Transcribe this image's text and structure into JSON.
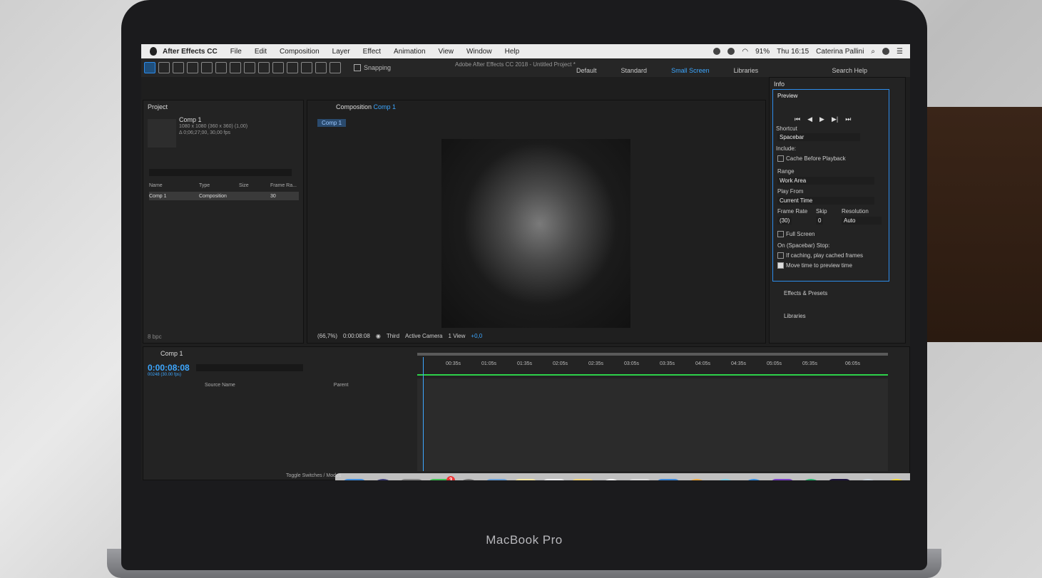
{
  "menubar": {
    "app": "After Effects CC",
    "items": [
      "File",
      "Edit",
      "Composition",
      "Layer",
      "Effect",
      "Animation",
      "View",
      "Window",
      "Help"
    ],
    "battery": "91%",
    "clock": "Thu 16:15",
    "user": "Caterina Pallini"
  },
  "toolbar": {
    "window_title": "Adobe After Effects CC 2018 - Untitled Project *",
    "snapping": "Snapping",
    "workspaces": [
      "Default",
      "Standard",
      "Small Screen",
      "Libraries"
    ],
    "active_workspace": "Small Screen",
    "search_help": "Search Help"
  },
  "project": {
    "title": "Project",
    "comp_name": "Comp 1",
    "comp_info_line1": "1080 x 1080 (360 x 360) (1,00)",
    "comp_info_line2": "Δ 0;06;27;00, 30,00 fps",
    "columns": [
      "Name",
      "Type",
      "Size",
      "Frame Ra..."
    ],
    "row": {
      "name": "Comp 1",
      "type": "Composition",
      "frame_rate": "30"
    },
    "bpc": "8 bpc"
  },
  "composition": {
    "panel_title": "Composition",
    "comp_link": "Comp 1",
    "tab": "Comp 1",
    "zoom": "(66,7%)",
    "timecode": "0:00:08:08",
    "resolution": "Third",
    "camera": "Active Camera",
    "views": "1 View",
    "exposure": "+0,0"
  },
  "right_panel": {
    "info": "Info",
    "preview": "Preview",
    "shortcut_label": "Shortcut",
    "shortcut_value": "Spacebar",
    "include_label": "Include:",
    "cache_before": "Cache Before Playback",
    "range_label": "Range",
    "range_value": "Work Area",
    "play_from_label": "Play From",
    "play_from_value": "Current Time",
    "frame_rate_label": "Frame Rate",
    "skip_label": "Skip",
    "resolution_label": "Resolution",
    "frame_rate_value": "(30)",
    "skip_value": "0",
    "resolution_value": "Auto",
    "full_screen": "Full Screen",
    "on_stop": "On (Spacebar) Stop:",
    "if_caching": "If caching, play cached frames",
    "move_time": "Move time to preview time",
    "effects_presets": "Effects & Presets",
    "libraries": "Libraries"
  },
  "timeline": {
    "tab": "Comp 1",
    "timecode": "0:00:08:08",
    "timecode_sub": "00248 (30.00 fps)",
    "col_source": "Source Name",
    "col_parent": "Parent",
    "ruler": [
      "00:35s",
      "01:05s",
      "01:35s",
      "02:05s",
      "02:35s",
      "03:05s",
      "03:35s",
      "04:05s",
      "04:35s",
      "05:05s",
      "05:35s",
      "06:05s"
    ],
    "toggle": "Toggle Switches / Modes"
  },
  "dock": {
    "ae_label": "Ae",
    "messages_badge": "3"
  },
  "laptop_label": "MacBook Pro"
}
